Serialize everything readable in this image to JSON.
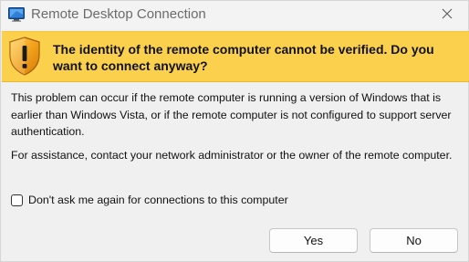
{
  "window": {
    "title": "Remote Desktop Connection",
    "icon": "remote-desktop-icon",
    "close_icon": "close-icon"
  },
  "banner": {
    "icon": "warning-shield-icon",
    "heading": "The identity of the remote computer cannot be verified. Do you want to connect anyway?",
    "background_color": "#fbd04c"
  },
  "body": {
    "paragraph1": "This problem can occur if the remote computer is running a version of Windows that is earlier than Windows Vista, or if the remote computer is not configured to support server authentication.",
    "paragraph2": "For assistance, contact your network administrator or the owner of the remote computer."
  },
  "checkbox": {
    "label": "Don't ask me again for connections to this computer",
    "checked": false
  },
  "buttons": {
    "yes_label": "Yes",
    "no_label": "No"
  }
}
